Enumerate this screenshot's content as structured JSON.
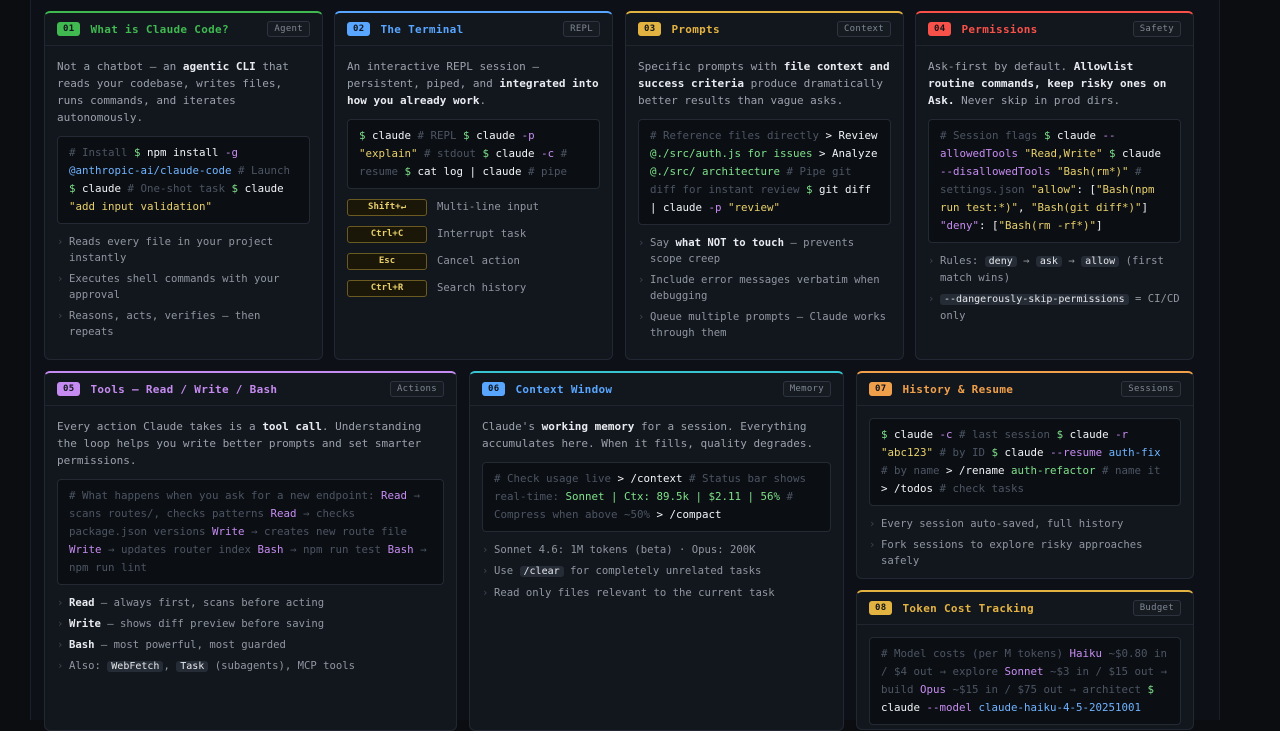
{
  "colors": {
    "green": "#3fb950",
    "blue": "#58a6ff",
    "yellow": "#e3b341",
    "red": "#f85149",
    "purple": "#c58bf0",
    "cyan": "#39c5cf",
    "orange": "#f0a04b"
  },
  "cards": [
    {
      "num": "01",
      "title": "What is Claude Code?",
      "tag": "Agent",
      "desc": [
        "Not a chatbot — an ",
        {
          "b": "agentic CLI"
        },
        " that reads your codebase, writes files, runs commands, and iterates autonomously."
      ],
      "code": [
        [
          "cm",
          "# Install "
        ],
        [
          "pr",
          "$ "
        ],
        [
          "cmd",
          "npm install "
        ],
        [
          "ar",
          "-g "
        ],
        [
          "fl",
          "@anthropic-ai/claude-code"
        ],
        [
          "cm",
          " # Launch "
        ],
        [
          "pr",
          "$ "
        ],
        [
          "cmd",
          "claude"
        ],
        [
          "cm",
          " # One-shot task "
        ],
        [
          "pr",
          "$ "
        ],
        [
          "cmd",
          "claude "
        ],
        [
          "str",
          "\"add input validation\""
        ]
      ],
      "bullets": [
        "Reads every file in your project instantly",
        "Executes shell commands with your approval",
        "Reasons, acts, verifies — then repeats"
      ]
    },
    {
      "num": "02",
      "title": "The Terminal",
      "tag": "REPL",
      "desc": [
        "An interactive REPL session — persistent, piped, and ",
        {
          "b": "integrated into how you already work"
        },
        "."
      ],
      "code": [
        [
          "pr",
          "$ "
        ],
        [
          "cmd",
          "claude"
        ],
        [
          "cm",
          " # REPL "
        ],
        [
          "pr",
          "$ "
        ],
        [
          "cmd",
          "claude "
        ],
        [
          "ar",
          "-p "
        ],
        [
          "str",
          "\"explain\""
        ],
        [
          "cm",
          " # stdout "
        ],
        [
          "pr",
          "$ "
        ],
        [
          "cmd",
          "claude "
        ],
        [
          "ar",
          "-c"
        ],
        [
          "cm",
          " # resume "
        ],
        [
          "pr",
          "$ "
        ],
        [
          "cmd",
          "cat log | claude"
        ],
        [
          "cm",
          " # pipe"
        ]
      ],
      "keys": [
        {
          "key": "Shift+↵",
          "label": "Multi-line input"
        },
        {
          "key": "Ctrl+C",
          "label": "Interrupt task"
        },
        {
          "key": "Esc",
          "label": "Cancel action"
        },
        {
          "key": "Ctrl+R",
          "label": "Search history"
        }
      ]
    },
    {
      "num": "03",
      "title": "Prompts",
      "tag": "Context",
      "desc": [
        "Specific prompts with ",
        {
          "b": "file context and success criteria"
        },
        " produce dramatically better results than vague asks."
      ],
      "code": [
        [
          "cm",
          "# Reference files directly "
        ],
        [
          "cmd",
          "> Review "
        ],
        [
          "pr",
          "@./src/auth.js for issues "
        ],
        [
          "cmd",
          "> Analyze "
        ],
        [
          "pr",
          "@./src/ architecture"
        ],
        [
          "cm",
          " # Pipe git diff for instant review "
        ],
        [
          "pr",
          "$ "
        ],
        [
          "cmd",
          "git diff | claude "
        ],
        [
          "ar",
          "-p "
        ],
        [
          "str",
          "\"review\""
        ]
      ],
      "bullets": [
        [
          "Say ",
          {
            "b": "what NOT to touch"
          },
          " — prevents scope creep"
        ],
        "Include error messages verbatim when debugging",
        "Queue multiple prompts — Claude works through them"
      ]
    },
    {
      "num": "04",
      "title": "Permissions",
      "tag": "Safety",
      "desc": [
        "Ask-first by default. ",
        {
          "b": "Allowlist routine commands, keep risky ones on Ask."
        },
        " Never skip in prod dirs."
      ],
      "code": [
        [
          "cm",
          "# Session flags "
        ],
        [
          "pr",
          "$ "
        ],
        [
          "cmd",
          "claude "
        ],
        [
          "ar",
          "--allowedTools "
        ],
        [
          "str",
          "\"Read,Write\" "
        ],
        [
          "pr",
          "$ "
        ],
        [
          "cmd",
          "claude "
        ],
        [
          "ar",
          "--disallowedTools "
        ],
        [
          "str",
          "\"Bash(rm*)\""
        ],
        [
          "cm",
          " # settings.json "
        ],
        [
          "str",
          "\"allow\""
        ],
        [
          "cmd",
          ": ["
        ],
        [
          "str",
          "\"Bash(npm run test:*)\""
        ],
        [
          "cmd",
          ", "
        ],
        [
          "str",
          "\"Bash(git diff*)\""
        ],
        [
          "cmd",
          "] "
        ],
        [
          "ar",
          "\"deny\""
        ],
        [
          "cmd",
          ": ["
        ],
        [
          "str",
          "\"Bash(rm -rf*)\""
        ],
        [
          "cmd",
          "]"
        ]
      ],
      "bullets": [
        [
          "Rules: ",
          {
            "k": "deny"
          },
          " → ",
          {
            "k": "ask"
          },
          " → ",
          {
            "k": "allow"
          },
          " (first match wins)"
        ],
        [
          {
            "k": "--dangerously-skip-permissions"
          },
          " = CI/CD only"
        ]
      ]
    },
    {
      "num": "05",
      "title": "Tools — Read / Write / Bash",
      "tag": "Actions",
      "desc": [
        "Every action Claude takes is a ",
        {
          "b": "tool call"
        },
        ". Understanding the loop helps you write better prompts and set smarter permissions."
      ],
      "code": [
        [
          "cm",
          "# What happens when you ask for a new endpoint: "
        ],
        [
          "tool",
          "Read"
        ],
        [
          "cm",
          " → scans routes/, checks patterns "
        ],
        [
          "tool",
          "Read"
        ],
        [
          "cm",
          " → checks package.json versions "
        ],
        [
          "tool",
          "Write"
        ],
        [
          "cm",
          " → creates new route file "
        ],
        [
          "tool",
          "Write"
        ],
        [
          "cm",
          " → updates router index "
        ],
        [
          "tool",
          "Bash"
        ],
        [
          "cm",
          " → npm run test "
        ],
        [
          "tool",
          "Bash"
        ],
        [
          "cm",
          " → npm run lint"
        ]
      ],
      "bullets": [
        [
          {
            "b": "Read"
          },
          " — always first, scans before acting"
        ],
        [
          {
            "b": "Write"
          },
          " — shows diff preview before saving"
        ],
        [
          {
            "b": "Bash"
          },
          " — most powerful, most guarded"
        ],
        [
          "Also: ",
          {
            "k": "WebFetch"
          },
          ", ",
          {
            "k": "Task"
          },
          " (subagents), MCP tools"
        ]
      ]
    },
    {
      "num": "06",
      "title": "Context Window",
      "tag": "Memory",
      "desc": [
        "Claude's ",
        {
          "b": "working memory"
        },
        " for a session. Everything accumulates here. When it fills, quality degrades."
      ],
      "code": [
        [
          "cm",
          "# Check usage live "
        ],
        [
          "cmd",
          "> /context"
        ],
        [
          "cm",
          " # Status bar shows real-time: "
        ],
        [
          "pr",
          "Sonnet | Ctx: 89.5k | $2.11 | 56%"
        ],
        [
          "cm",
          " # Compress when above ~50% "
        ],
        [
          "cmd",
          "> /compact"
        ]
      ],
      "bullets": [
        "Sonnet 4.6: 1M tokens (beta) · Opus: 200K",
        [
          "Use ",
          {
            "k": "/clear"
          },
          " for completely unrelated tasks"
        ],
        "Read only files relevant to the current task"
      ]
    },
    {
      "num": "07",
      "title": "History & Resume",
      "tag": "Sessions",
      "code": [
        [
          "pr",
          "$ "
        ],
        [
          "cmd",
          "claude "
        ],
        [
          "ar",
          "-c"
        ],
        [
          "cm",
          " # last session "
        ],
        [
          "pr",
          "$ "
        ],
        [
          "cmd",
          "claude "
        ],
        [
          "ar",
          "-r "
        ],
        [
          "str",
          "\"abc123\""
        ],
        [
          "cm",
          " # by ID "
        ],
        [
          "pr",
          "$ "
        ],
        [
          "cmd",
          "claude "
        ],
        [
          "ar",
          "--resume "
        ],
        [
          "fl",
          "auth-fix"
        ],
        [
          "cm",
          " # by name "
        ],
        [
          "cmd",
          "> /rename "
        ],
        [
          "pr",
          "auth-refactor"
        ],
        [
          "cm",
          " # name it "
        ],
        [
          "cmd",
          "> /todos"
        ],
        [
          "cm",
          " # check tasks"
        ]
      ],
      "bullets": [
        "Every session auto-saved, full history",
        "Fork sessions to explore risky approaches safely"
      ]
    },
    {
      "num": "08",
      "title": "Token Cost Tracking",
      "tag": "Budget",
      "code": [
        [
          "cm",
          "# Model costs (per M tokens) "
        ],
        [
          "tool",
          "Haiku"
        ],
        [
          "cm",
          " ~$0.80 in / $4 out → explore "
        ],
        [
          "tool",
          "Sonnet"
        ],
        [
          "cm",
          " ~$3 in / $15 out → build "
        ],
        [
          "tool",
          "Opus"
        ],
        [
          "cm",
          " ~$15 in / $75 out → architect "
        ],
        [
          "pr",
          "$ "
        ],
        [
          "cmd",
          "claude "
        ],
        [
          "ar",
          "--model "
        ],
        [
          "fl",
          "claude-haiku-4-5-20251001"
        ]
      ]
    }
  ]
}
